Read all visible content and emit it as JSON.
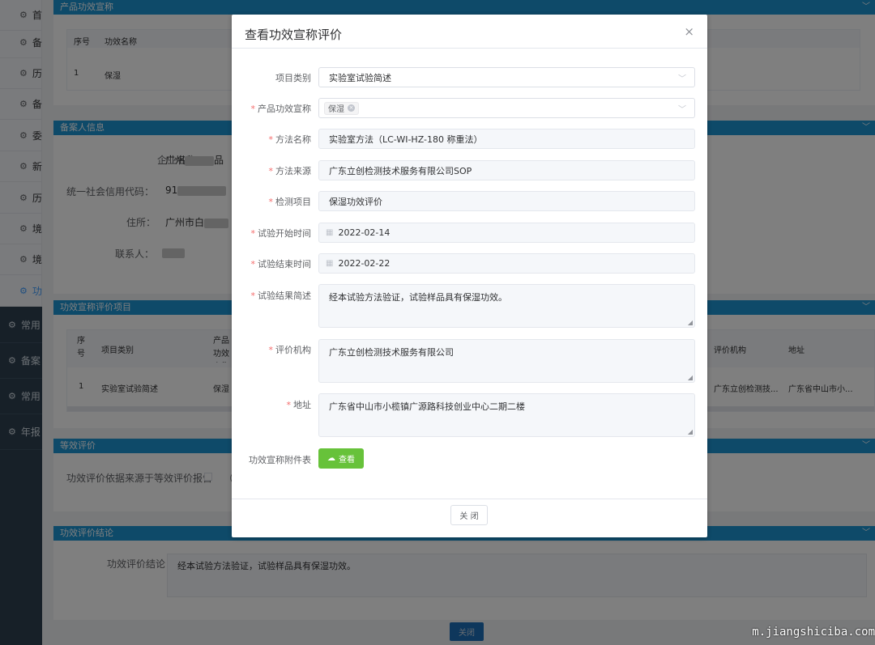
{
  "sidebar": {
    "items": [
      {
        "label": "首"
      },
      {
        "label": "备"
      },
      {
        "label": "历"
      },
      {
        "label": "备"
      },
      {
        "label": "委"
      },
      {
        "label": "新"
      },
      {
        "label": "历"
      },
      {
        "label": "境"
      },
      {
        "label": "境"
      },
      {
        "label": "功"
      }
    ],
    "groups": [
      {
        "label": "常用"
      },
      {
        "label": "备案"
      },
      {
        "label": "常用"
      },
      {
        "label": "年报"
      }
    ]
  },
  "bg": {
    "panel1_title": "产品功效宣称",
    "panel1_table": {
      "col1": "序号",
      "col2": "功效名称",
      "row_no": "1",
      "row_name": "保湿"
    },
    "panel2_title": "备案人信息",
    "company_label": "企业名称：",
    "company_value": "广州",
    "company_suffix": "品",
    "credit_label": "统一社会信用代码：",
    "credit_value": "91",
    "address_label": "住所：",
    "address_value": "广州市白",
    "contact_label": "联系人：",
    "panel3_title": "功效宣称评价项目",
    "panel3_table": {
      "col_seq": "序号",
      "col_type": "项目类别",
      "col_claim": "产品功效宣称",
      "col_org": "评价机构",
      "col_addr": "地址",
      "row_no": "1",
      "row_type": "实验室试验简述",
      "row_claim": "保湿",
      "row_org": "广东立创检测技...",
      "row_addr": "广东省中山市小..."
    },
    "panel4_title": "等效评价",
    "equiv_text": "功效评价依据来源于等效评价报告",
    "equiv_paren": "（",
    "panel5_title": "功效评价结论",
    "conclusion_label": "功效评价结论：",
    "conclusion_value": "经本试验方法验证，试验样品具有保湿功效。",
    "bottom_close": "关闭"
  },
  "dialog": {
    "title": "查看功效宣称评价",
    "fields": {
      "category_label": "项目类别",
      "category_value": "实验室试验简述",
      "claim_label": "产品功效宣称",
      "claim_tag": "保湿",
      "method_label": "方法名称",
      "method_value": "实验室方法（LC-WI-HZ-180 称重法）",
      "source_label": "方法来源",
      "source_value": "广东立创检测技术服务有限公司SOP",
      "item_label": "检测项目",
      "item_value": "保湿功效评价",
      "start_label": "试验开始时间",
      "start_value": "2022-02-14",
      "end_label": "试验结束时间",
      "end_value": "2022-02-22",
      "result_label": "试验结果简述",
      "result_value": "经本试验方法验证，试验样品具有保湿功效。",
      "org_label": "评价机构",
      "org_value": "广东立创检测技术服务有限公司",
      "addr_label": "地址",
      "addr_value": "广东省中山市小榄镇广源路科技创业中心二期二楼",
      "attach_label": "功效宣称附件表"
    },
    "view_button": "查看",
    "close_button": "关 闭",
    "required_mark": "*"
  },
  "watermark": "m.jiangshiciba.com",
  "icons": {
    "gear": "⚙",
    "chevron": "﹀",
    "close": "×",
    "calendar": "▦",
    "cloud": "☁"
  }
}
